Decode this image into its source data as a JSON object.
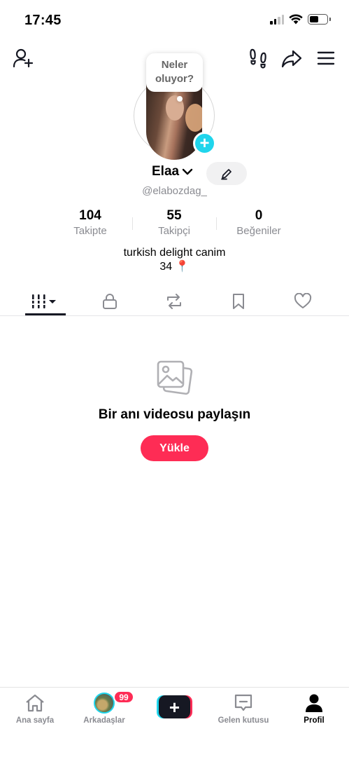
{
  "status_bar": {
    "time": "17:45"
  },
  "top_bar": {
    "icons": [
      "add-friend-icon",
      "footprints-icon",
      "share-icon",
      "menu-icon"
    ]
  },
  "profile": {
    "status_bubble": "Neler oluyor?",
    "name": "Elaa",
    "username": "@elabozdag_",
    "stats": [
      {
        "value": "104",
        "label": "Takipte"
      },
      {
        "value": "55",
        "label": "Takipçi"
      },
      {
        "value": "0",
        "label": "Beğeniler"
      }
    ],
    "bio_line1": "turkish delight canim",
    "bio_line2": "34 📍"
  },
  "tabs": [
    "videos-grid-icon",
    "lock-icon",
    "repost-icon",
    "bookmark-icon",
    "heart-icon"
  ],
  "empty_state": {
    "title": "Bir anı videosu paylaşın",
    "button": "Yükle"
  },
  "bottom_nav": {
    "home": "Ana sayfa",
    "friends": "Arkadaşlar",
    "friends_badge": "99",
    "inbox": "Gelen kutusu",
    "profile": "Profil"
  },
  "colors": {
    "accent": "#fe2c55",
    "cyan": "#20d5ec",
    "text": "#161823",
    "muted": "#8a8b91"
  }
}
